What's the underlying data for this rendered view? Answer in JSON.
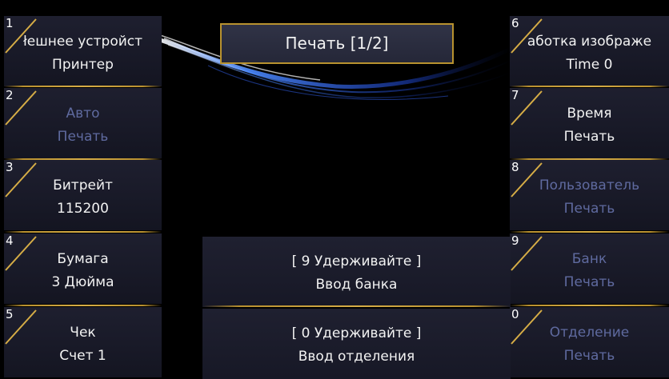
{
  "title": "Печать [1/2]",
  "left_buttons": [
    {
      "num": "1",
      "line1": "łешнее устройст",
      "line2": "Принтер",
      "dim": false
    },
    {
      "num": "2",
      "line1": "Авто",
      "line2": "Печать",
      "dim": true
    },
    {
      "num": "3",
      "line1": "Битрейт",
      "line2": "115200",
      "dim": false
    },
    {
      "num": "4",
      "line1": "Бумага",
      "line2": "3 Дюйма",
      "dim": false
    },
    {
      "num": "5",
      "line1": "Чек",
      "line2": "Счет 1",
      "dim": false
    }
  ],
  "right_buttons": [
    {
      "num": "6",
      "line1": "аботка изображе",
      "line2": "Time 0",
      "dim": false
    },
    {
      "num": "7",
      "line1": "Время",
      "line2": "Печать",
      "dim": false
    },
    {
      "num": "8",
      "line1": "Пользователь",
      "line2": "Печать",
      "dim": true
    },
    {
      "num": "9",
      "line1": "Банк",
      "line2": "Печать",
      "dim": true
    },
    {
      "num": "0",
      "line1": "Отделение",
      "line2": "Печать",
      "dim": true
    }
  ],
  "center_panels": [
    {
      "line1": "[ 9 Удерживайте ]",
      "line2": "Ввод банка"
    },
    {
      "line1": "[ 0 Удерживайте ]",
      "line2": "Ввод отделения"
    }
  ],
  "colors": {
    "background": "#000000",
    "gold_accent": "#b8922f",
    "text": "#f2f2f2",
    "dim_text": "#5f6a9f",
    "swoosh": "#2e6bff"
  }
}
